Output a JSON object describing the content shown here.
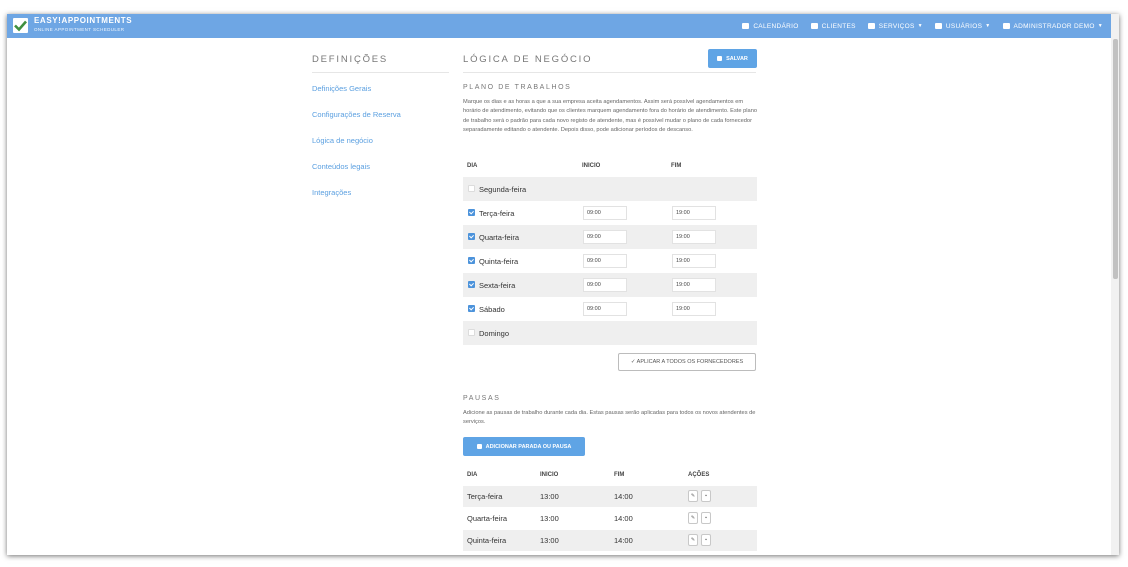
{
  "brand": {
    "name": "EASY!APPOINTMENTS",
    "subtitle": "ONLINE APPOINTMENT SCHEDULER"
  },
  "nav": [
    {
      "label": "CALENDÁRIO",
      "icon": "calendar-icon",
      "dropdown": false
    },
    {
      "label": "CLIENTES",
      "icon": "users-icon",
      "dropdown": false
    },
    {
      "label": "SERVIÇOS",
      "icon": "cubes-icon",
      "dropdown": true
    },
    {
      "label": "USUÁRIOS",
      "icon": "user-group-icon",
      "dropdown": true
    },
    {
      "label": "ADMINISTRADOR DEMO",
      "icon": "user-icon",
      "dropdown": true
    }
  ],
  "sidebar": {
    "title": "DEFINIÇÕES",
    "items": [
      "Definições Gerais",
      "Configurações de Reserva",
      "Lógica de negócio",
      "Conteúdos legais",
      "Integrações"
    ]
  },
  "main": {
    "title": "LÓGICA DE NEGÓCIO",
    "save_label": "SALVAR"
  },
  "work_plan": {
    "title": "PLANO DE TRABALHOS",
    "description": "Marque os dias e as horas a que a sua empresa aceita agendamentos. Assim será possível agendamentos em horário de atendimento, evitando que os clientes marquem agendamento fora do horário de atendimento. Este plano de trabalho será o padrão para cada novo registo de atendente, mas é possível mudar o plano de cada fornecedor separadamente editando o atendente. Depois disso, pode adicionar períodos de descanso.",
    "headers": {
      "day": "DIA",
      "start": "INICIO",
      "end": "FIM"
    },
    "rows": [
      {
        "day": "Segunda-feira",
        "checked": false,
        "start": "",
        "end": ""
      },
      {
        "day": "Terça-feira",
        "checked": true,
        "start": "09:00",
        "end": "19:00"
      },
      {
        "day": "Quarta-feira",
        "checked": true,
        "start": "09:00",
        "end": "19:00"
      },
      {
        "day": "Quinta-feira",
        "checked": true,
        "start": "09:00",
        "end": "19:00"
      },
      {
        "day": "Sexta-feira",
        "checked": true,
        "start": "09:00",
        "end": "19:00"
      },
      {
        "day": "Sábado",
        "checked": true,
        "start": "09:00",
        "end": "19:00"
      },
      {
        "day": "Domingo",
        "checked": false,
        "start": "",
        "end": ""
      }
    ],
    "apply_label": "✓ APLICAR A TODOS OS FORNECEDORES"
  },
  "breaks": {
    "title": "PAUSAS",
    "description": "Adicione as pausas de trabalho durante cada dia. Estas pausas serão aplicadas para todos os novos atendentes de serviços.",
    "add_label": "ADICIONAR PARADA OU PAUSA",
    "headers": {
      "day": "DIA",
      "start": "INICIO",
      "end": "FIM",
      "actions": "AÇÕES"
    },
    "rows": [
      {
        "day": "Terça-feira",
        "start": "13:00",
        "end": "14:00"
      },
      {
        "day": "Quarta-feira",
        "start": "13:00",
        "end": "14:00"
      },
      {
        "day": "Quinta-feira",
        "start": "13:00",
        "end": "14:00"
      }
    ]
  },
  "colors": {
    "accent": "#6ea6e4",
    "button": "#5fa4e5",
    "link": "#5a9fe0"
  }
}
